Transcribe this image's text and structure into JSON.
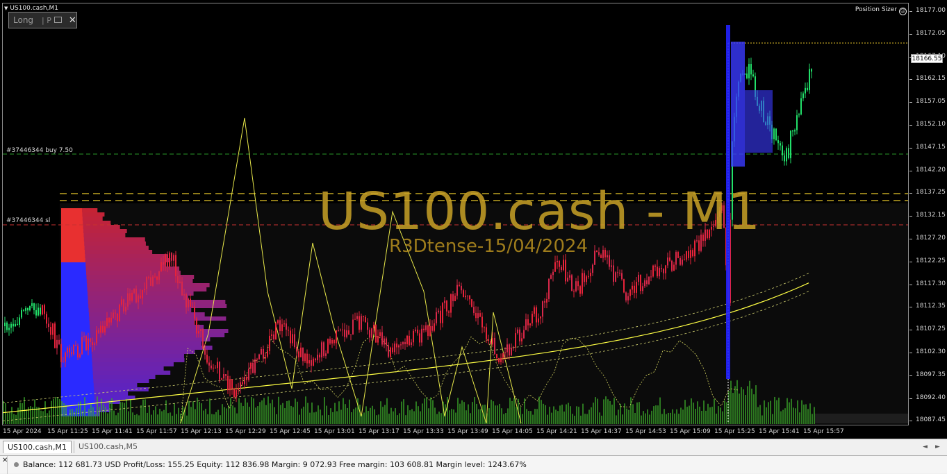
{
  "chart": {
    "symbol_label": "US100.cash,M1",
    "trade_panel": {
      "direction": "Long",
      "p_label": "P",
      "close": "✕"
    },
    "position_sizer": "Position Sizer",
    "order_lines": {
      "buy": "#37446344 buy 7.50",
      "sl": "#37446344 sl"
    },
    "watermark": {
      "title": "US100.cash - M1",
      "subtitle": "R3Dtense-15/04/2024"
    },
    "current_price": "18166.55",
    "price_ticks": [
      "18177.00",
      "18172.05",
      "18167.10",
      "18162.15",
      "18157.05",
      "18152.10",
      "18147.15",
      "18142.20",
      "18137.25",
      "18132.15",
      "18127.20",
      "18122.25",
      "18117.30",
      "18112.35",
      "18107.25",
      "18102.30",
      "18097.35",
      "18092.40",
      "18087.45"
    ],
    "time_ticks": [
      "15 Apr 2024",
      "15 Apr 11:25",
      "15 Apr 11:41",
      "15 Apr 11:57",
      "15 Apr 12:13",
      "15 Apr 12:29",
      "15 Apr 12:45",
      "15 Apr 13:01",
      "15 Apr 13:17",
      "15 Apr 13:33",
      "15 Apr 13:49",
      "15 Apr 14:05",
      "15 Apr 14:21",
      "15 Apr 14:37",
      "15 Apr 14:53",
      "15 Apr 15:09",
      "15 Apr 15:25",
      "15 Apr 15:41",
      "15 Apr 15:57"
    ],
    "colors": {
      "background": "#000000",
      "bull": "#22e06a",
      "bear": "#e8233a",
      "watermark": "#c9a227",
      "indicator": "#ffff44",
      "volume": "#3aa62a"
    }
  },
  "tabs": [
    {
      "label": "US100.cash,M1",
      "active": true
    },
    {
      "label": "US100.cash,M5",
      "active": false
    }
  ],
  "tab_scroll": {
    "left": "◄",
    "right": "►"
  },
  "status": {
    "close_icon": "✕",
    "text": "Balance: 112 681.73 USD  Profit/Loss: 155.25  Equity: 112 836.98  Margin: 9 072.93  Free margin: 103 608.81  Margin level: 1243.67%"
  }
}
